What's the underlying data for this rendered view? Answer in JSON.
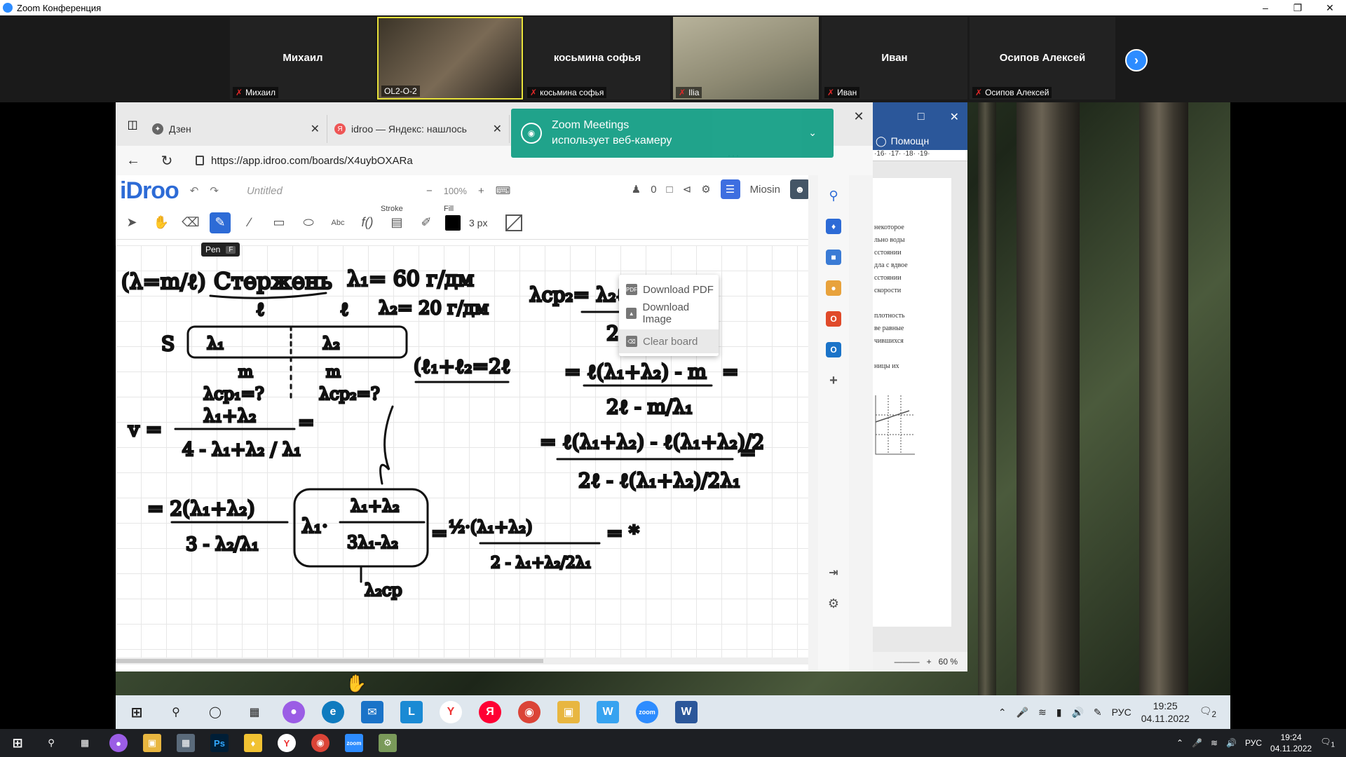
{
  "zoom_window": {
    "title": "Zoom Конференция"
  },
  "participants": [
    {
      "label": "Михаил",
      "tag": "Михаил"
    },
    {
      "label": "",
      "tag": "OL2-O-2"
    },
    {
      "label": "косьмина софья",
      "tag": "косьмина софья"
    },
    {
      "label": "",
      "tag": "Ilia"
    },
    {
      "label": "Иван",
      "tag": "Иван"
    },
    {
      "label": "Осипов Алексей",
      "tag": "Осипов Алексей"
    }
  ],
  "browser": {
    "tabs": [
      {
        "title": "Дзен"
      },
      {
        "title": "idroo — Яндекс: нашлось"
      }
    ],
    "url": "https://app.idroo.com/boards/X4uybOXARa"
  },
  "idroo": {
    "logo": "iDroo",
    "doc_title": "Untitled",
    "zoom": "100%",
    "users_count": "0",
    "username": "Miosin",
    "stroke_label": "Stroke",
    "fill_label": "Fill",
    "stroke_width": "3 px",
    "stroke_color": "#000000",
    "pen_tooltip": "Pen",
    "pen_shortcut": "F",
    "menu": [
      "Download PDF",
      "Download Image",
      "Clear board"
    ]
  },
  "toast": {
    "line1": "Zoom Meetings",
    "line2": "использует веб-камеру"
  },
  "word": {
    "help": "Помощн",
    "ruler": "·16· ·17· ·18· ·19·",
    "snippets": [
      "некоторое",
      "льно воды",
      "сстоянии",
      "дла с вдвое",
      "сстоянии",
      "скорости",
      "плотность",
      "ве равные",
      "чившихся",
      "ницы их"
    ],
    "zoom": "60 %"
  },
  "remote_taskbar": {
    "lang": "РУС",
    "time": "19:25",
    "date": "04.11.2022",
    "notif_count": "2"
  },
  "local_taskbar": {
    "lang": "РУС",
    "time": "19:24",
    "date": "04.11.2022",
    "notif_count": "1"
  },
  "colors": {
    "zoom_blue": "#2d8cff",
    "idroo_blue": "#2d6bd6",
    "toast_green": "#1aa188",
    "word_blue": "#2b579a"
  }
}
